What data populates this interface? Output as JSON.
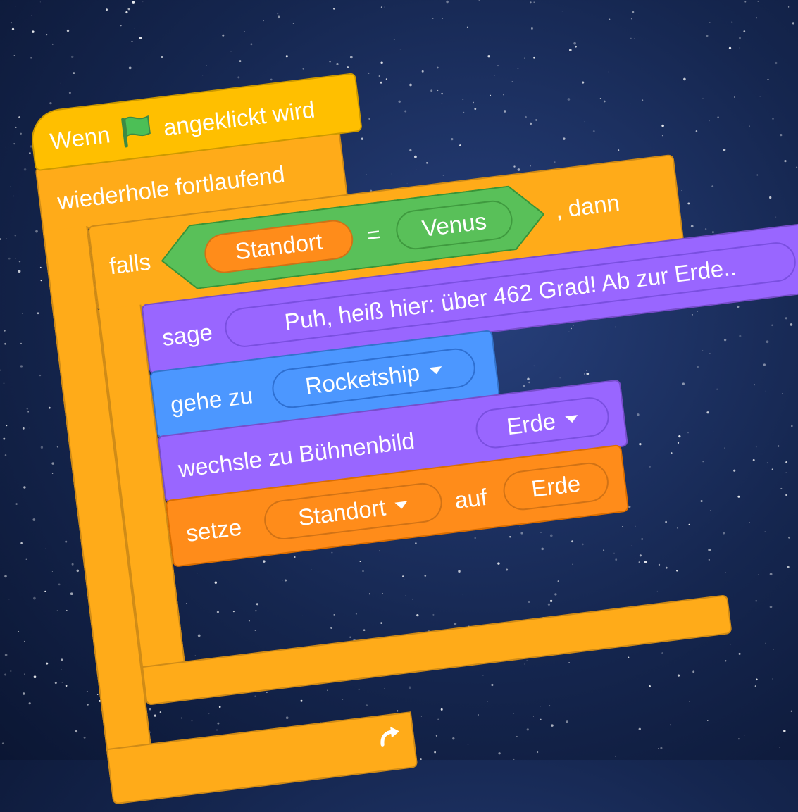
{
  "hat": {
    "prefix": "Wenn",
    "suffix": "angeklickt wird"
  },
  "forever": {
    "label": "wiederhole fortlaufend"
  },
  "if_block": {
    "keyword": "falls",
    "then": ", dann",
    "condition": {
      "variable": "Standort",
      "operator": "=",
      "value": "Venus"
    }
  },
  "say": {
    "keyword": "sage",
    "message": "Puh, heiß hier: über 462 Grad! Ab zur Erde.."
  },
  "goto": {
    "keyword": "gehe zu",
    "target": "Rocketship"
  },
  "backdrop": {
    "keyword": "wechsle zu Bühnenbild",
    "value": "Erde"
  },
  "setvar": {
    "keyword": "setze",
    "variable": "Standort",
    "to": "auf",
    "value": "Erde"
  },
  "colors": {
    "events": "#ffbf00",
    "control": "#ffab19",
    "operators": "#59c059",
    "looks": "#9966ff",
    "motion": "#4c97ff",
    "variables": "#ff8c1a",
    "flag": "#4cbf56"
  },
  "icons": {
    "start_flag": "green-flag-icon",
    "loop_arrow": "loop-arrow-icon",
    "dropdown": "dropdown-caret-icon"
  }
}
